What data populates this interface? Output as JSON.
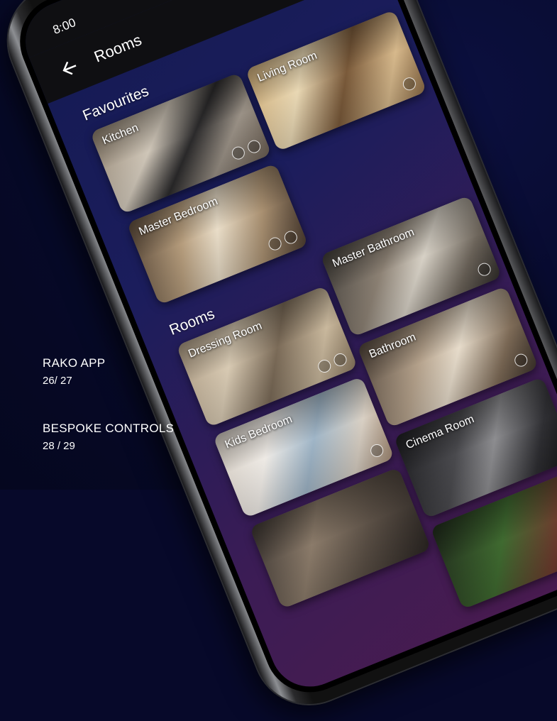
{
  "status": {
    "time": "8:00"
  },
  "appbar": {
    "title": "Rooms"
  },
  "sections": {
    "favourites": "Favourites",
    "rooms": "Rooms"
  },
  "favourites": [
    {
      "label": "Kitchen"
    },
    {
      "label": "Living Room"
    },
    {
      "label": "Master Bedroom"
    }
  ],
  "rooms": [
    {
      "label": "Master Bathroom"
    },
    {
      "label": "Dressing Room"
    },
    {
      "label": "Bathroom"
    },
    {
      "label": "Kids Bedroom"
    },
    {
      "label": "Cinema Room"
    },
    {
      "label": ""
    },
    {
      "label": ""
    }
  ],
  "captions": [
    {
      "title": "RAKO APP",
      "pages": "26/ 27"
    },
    {
      "title": "BESPOKE CONTROLS",
      "pages": "28 / 29"
    }
  ]
}
